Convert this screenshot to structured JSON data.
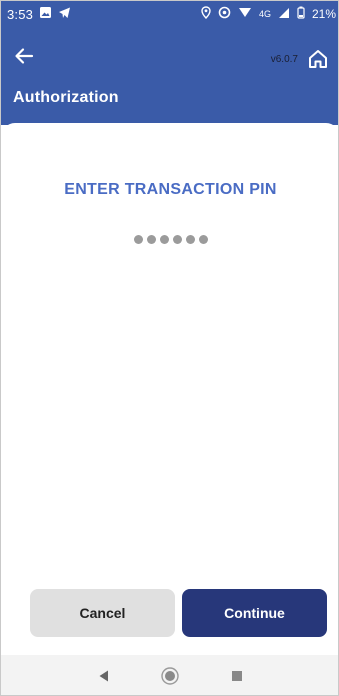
{
  "status_bar": {
    "time": "3:53",
    "network": "4G",
    "battery": "21%",
    "icons": [
      "gallery-icon",
      "telegram-icon",
      "location-icon",
      "data-saver-icon",
      "wifi-icon",
      "signal-icon",
      "battery-icon"
    ]
  },
  "header": {
    "version": "v6.0.7",
    "title": "Authorization",
    "back_icon": "arrow-left-icon",
    "home_icon": "home-icon"
  },
  "pin_entry": {
    "prompt": "ENTER TRANSACTION PIN",
    "dots_count": 6
  },
  "actions": {
    "cancel_label": "Cancel",
    "continue_label": "Continue"
  },
  "nav_bar": {
    "icons": [
      "back-triangle-icon",
      "home-circle-icon",
      "recents-square-icon"
    ]
  },
  "colors": {
    "primary": "#3a5ba8",
    "prompt": "#4a6cc4",
    "continue_button": "#27377a",
    "cancel_button": "#e0e0e0"
  }
}
